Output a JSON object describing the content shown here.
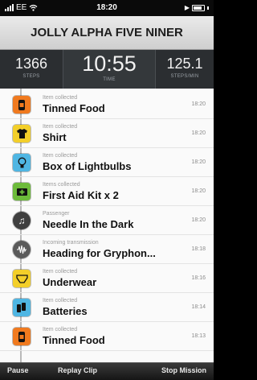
{
  "status_bar": {
    "carrier": "EE",
    "time": "18:20"
  },
  "header": {
    "title": "JOLLY ALPHA FIVE NINER"
  },
  "stats": {
    "steps": {
      "value": "1366",
      "label": "STEPS"
    },
    "time": {
      "value": "10:55",
      "label": "TIME"
    },
    "pace": {
      "value": "125.1",
      "label": "STEPS/MIN"
    }
  },
  "log": [
    {
      "category": "Item collected",
      "name": "Tinned Food",
      "time": "18:20",
      "icon": "tin-can-icon",
      "icon_color": "#f07a1f"
    },
    {
      "category": "Item collected",
      "name": "Shirt",
      "time": "18:20",
      "icon": "shirt-icon",
      "icon_color": "#f3cf2a"
    },
    {
      "category": "Item collected",
      "name": "Box of Lightbulbs",
      "time": "18:20",
      "icon": "lightbulb-icon",
      "icon_color": "#4fb6e3"
    },
    {
      "category": "Items collected",
      "name": "First Aid Kit x 2",
      "time": "18:20",
      "icon": "first-aid-kit-icon",
      "icon_color": "#6dbb3b"
    },
    {
      "category": "Passenger",
      "name": "Needle In the Dark",
      "time": "18:20",
      "icon": "music-note-icon",
      "icon_color": "#3f3f3f"
    },
    {
      "category": "Incoming transmission",
      "name": "Heading for Gryphon...",
      "time": "18:18",
      "icon": "waveform-icon",
      "icon_color": "#5a5a5a"
    },
    {
      "category": "Item collected",
      "name": "Underwear",
      "time": "18:16",
      "icon": "underwear-icon",
      "icon_color": "#f3cf2a"
    },
    {
      "category": "Item collected",
      "name": "Batteries",
      "time": "18:14",
      "icon": "batteries-icon",
      "icon_color": "#4fb6e3"
    },
    {
      "category": "Item collected",
      "name": "Tinned Food",
      "time": "18:13",
      "icon": "tin-can-icon",
      "icon_color": "#f07a1f"
    }
  ],
  "toolbar": {
    "pause_label": "Pause",
    "replay_label": "Replay Clip",
    "stop_label": "Stop Mission"
  }
}
